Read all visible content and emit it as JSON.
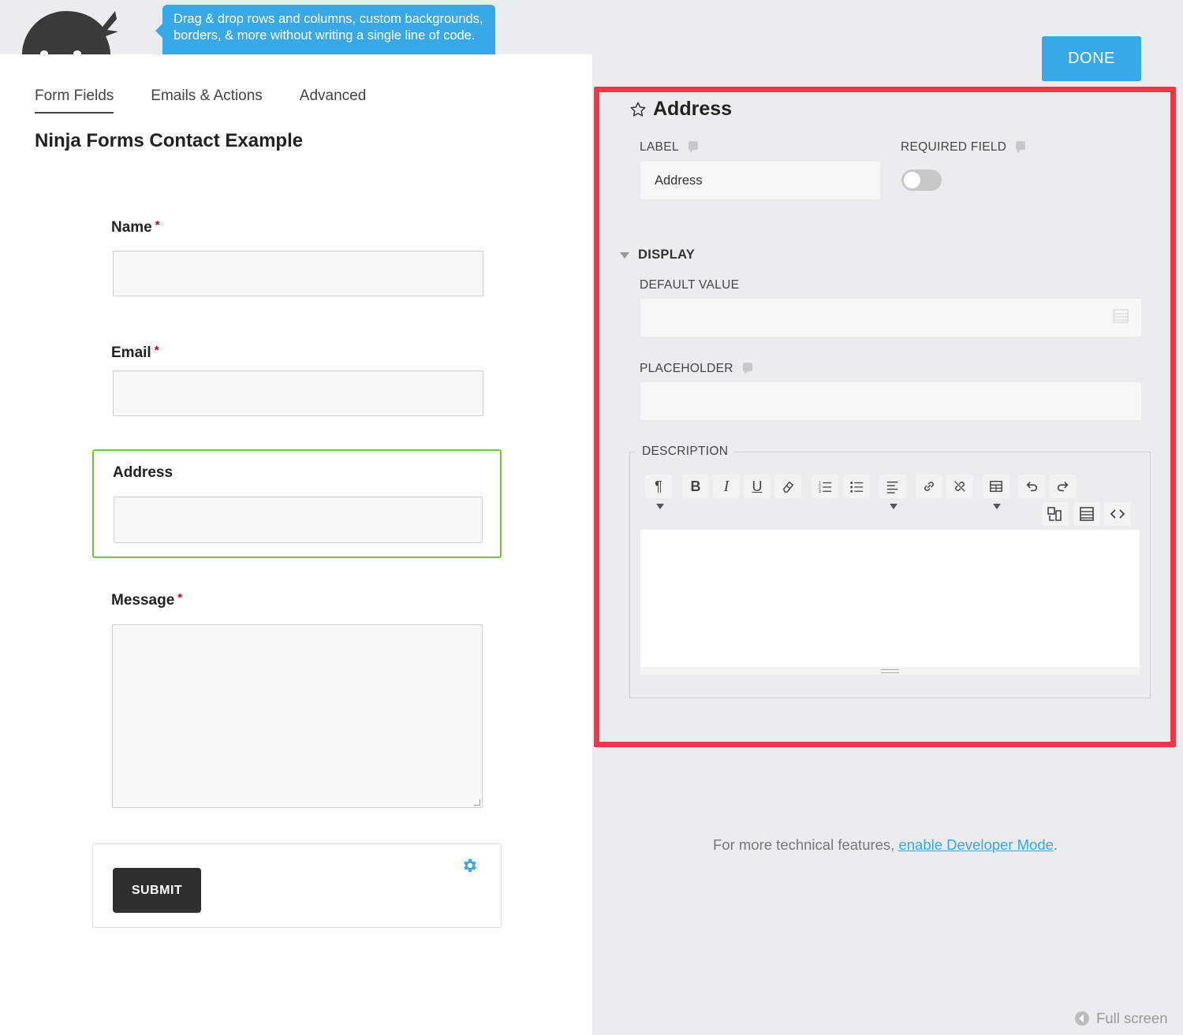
{
  "tooltip": {
    "text": "Drag & drop rows and columns, custom backgrounds, borders, & more without writing a single line of code."
  },
  "tabs": [
    {
      "label": "Form Fields",
      "active": true
    },
    {
      "label": "Emails & Actions",
      "active": false
    },
    {
      "label": "Advanced",
      "active": false
    }
  ],
  "form": {
    "title": "Ninja Forms Contact Example",
    "fields": [
      {
        "label": "Name",
        "required": true,
        "required_mark": "*"
      },
      {
        "label": "Email",
        "required": true,
        "required_mark": "*"
      },
      {
        "label": "Address",
        "required": false
      },
      {
        "label": "Message",
        "required": true,
        "required_mark": "*"
      }
    ],
    "submit_label": "SUBMIT"
  },
  "drawer": {
    "done_label": "DONE",
    "title": "Address",
    "label_heading": "LABEL",
    "label_value": "Address",
    "required_heading": "REQUIRED FIELD",
    "required_on": false,
    "display_heading": "DISPLAY",
    "default_value_heading": "DEFAULT VALUE",
    "default_value": "",
    "placeholder_heading": "PLACEHOLDER",
    "placeholder_value": "",
    "description_heading": "DESCRIPTION",
    "toolbar": [
      "paragraph-icon",
      "bold-icon",
      "italic-icon",
      "underline-icon",
      "eraser-icon",
      "ordered-list-icon",
      "unordered-list-icon",
      "align-icon",
      "link-icon",
      "unlink-icon",
      "table-icon",
      "undo-icon",
      "redo-icon",
      "merge-tags-icon",
      "text-block-icon",
      "code-view-icon"
    ],
    "toolbar_glyphs": {
      "bold": "B",
      "italic": "I",
      "underline": "U"
    }
  },
  "footer": {
    "prefix": "For more technical features, ",
    "link": "enable Developer Mode",
    "suffix": "."
  },
  "fullscreen_label": "Full screen",
  "colors": {
    "accent": "#39a8e6",
    "highlight_border": "#f2364a",
    "selected_field_border": "#7ac143",
    "required_star": "#d0021b",
    "submit_button": "#2f2f2f"
  }
}
